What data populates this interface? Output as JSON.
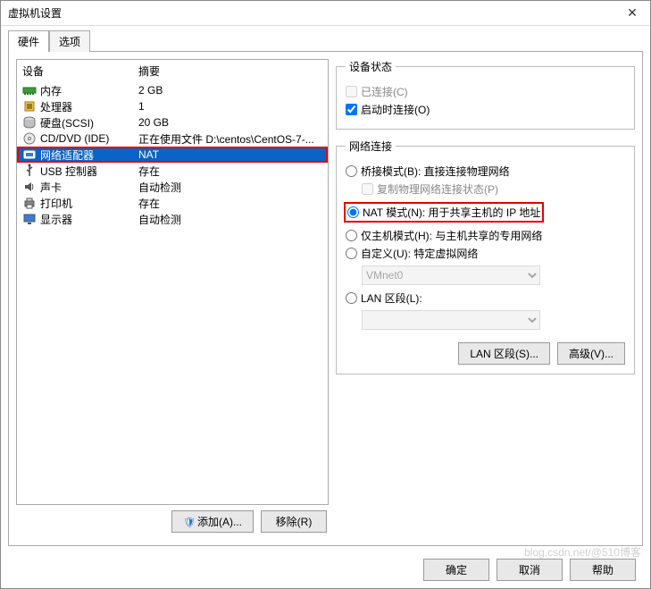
{
  "window": {
    "title": "虚拟机设置",
    "close": "✕"
  },
  "tabs": {
    "hardware": "硬件",
    "options": "选项"
  },
  "hw_table": {
    "col_device": "设备",
    "col_summary": "摘要",
    "rows": [
      {
        "id": "memory",
        "icon": "memory-icon",
        "label": "内存",
        "summary": "2 GB"
      },
      {
        "id": "cpu",
        "icon": "cpu-icon",
        "label": "处理器",
        "summary": "1"
      },
      {
        "id": "hdd",
        "icon": "hdd-icon",
        "label": "硬盘(SCSI)",
        "summary": "20 GB"
      },
      {
        "id": "cd",
        "icon": "cd-icon",
        "label": "CD/DVD (IDE)",
        "summary": "正在使用文件 D:\\centos\\CentOS-7-..."
      },
      {
        "id": "net",
        "icon": "net-icon",
        "label": "网络适配器",
        "summary": "NAT"
      },
      {
        "id": "usb",
        "icon": "usb-icon",
        "label": "USB 控制器",
        "summary": "存在"
      },
      {
        "id": "sound",
        "icon": "sound-icon",
        "label": "声卡",
        "summary": "自动检测"
      },
      {
        "id": "printer",
        "icon": "printer-icon",
        "label": "打印机",
        "summary": "存在"
      },
      {
        "id": "display",
        "icon": "display-icon",
        "label": "显示器",
        "summary": "自动检测"
      }
    ]
  },
  "actions": {
    "add": "添加(A)...",
    "remove": "移除(R)"
  },
  "status_grp": {
    "legend": "设备状态",
    "connected": "已连接(C)",
    "connect_on_power": "启动时连接(O)"
  },
  "net_grp": {
    "legend": "网络连接",
    "bridged": "桥接模式(B): 直接连接物理网络",
    "replicate": "复制物理网络连接状态(P)",
    "nat": "NAT 模式(N): 用于共享主机的 IP 地址",
    "hostonly": "仅主机模式(H): 与主机共享的专用网络",
    "custom": "自定义(U): 特定虚拟网络",
    "custom_value": "VMnet0",
    "lan": "LAN 区段(L):",
    "lan_value": "",
    "lan_btn": "LAN 区段(S)...",
    "adv_btn": "高级(V)..."
  },
  "dialog_btns": {
    "ok": "确定",
    "cancel": "取消",
    "help": "帮助"
  },
  "watermark": "blog.csdn.net/@510博客"
}
